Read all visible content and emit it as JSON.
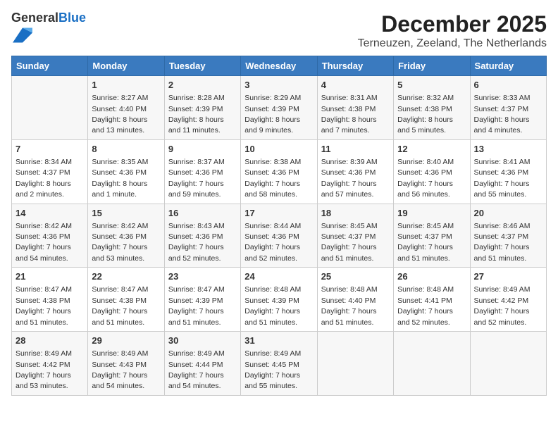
{
  "logo": {
    "general": "General",
    "blue": "Blue"
  },
  "title": "December 2025",
  "subtitle": "Terneuzen, Zeeland, The Netherlands",
  "days_of_week": [
    "Sunday",
    "Monday",
    "Tuesday",
    "Wednesday",
    "Thursday",
    "Friday",
    "Saturday"
  ],
  "weeks": [
    [
      {
        "day": null,
        "info": null
      },
      {
        "day": "1",
        "info": "Sunrise: 8:27 AM\nSunset: 4:40 PM\nDaylight: 8 hours\nand 13 minutes."
      },
      {
        "day": "2",
        "info": "Sunrise: 8:28 AM\nSunset: 4:39 PM\nDaylight: 8 hours\nand 11 minutes."
      },
      {
        "day": "3",
        "info": "Sunrise: 8:29 AM\nSunset: 4:39 PM\nDaylight: 8 hours\nand 9 minutes."
      },
      {
        "day": "4",
        "info": "Sunrise: 8:31 AM\nSunset: 4:38 PM\nDaylight: 8 hours\nand 7 minutes."
      },
      {
        "day": "5",
        "info": "Sunrise: 8:32 AM\nSunset: 4:38 PM\nDaylight: 8 hours\nand 5 minutes."
      },
      {
        "day": "6",
        "info": "Sunrise: 8:33 AM\nSunset: 4:37 PM\nDaylight: 8 hours\nand 4 minutes."
      }
    ],
    [
      {
        "day": "7",
        "info": "Sunrise: 8:34 AM\nSunset: 4:37 PM\nDaylight: 8 hours\nand 2 minutes."
      },
      {
        "day": "8",
        "info": "Sunrise: 8:35 AM\nSunset: 4:36 PM\nDaylight: 8 hours\nand 1 minute."
      },
      {
        "day": "9",
        "info": "Sunrise: 8:37 AM\nSunset: 4:36 PM\nDaylight: 7 hours\nand 59 minutes."
      },
      {
        "day": "10",
        "info": "Sunrise: 8:38 AM\nSunset: 4:36 PM\nDaylight: 7 hours\nand 58 minutes."
      },
      {
        "day": "11",
        "info": "Sunrise: 8:39 AM\nSunset: 4:36 PM\nDaylight: 7 hours\nand 57 minutes."
      },
      {
        "day": "12",
        "info": "Sunrise: 8:40 AM\nSunset: 4:36 PM\nDaylight: 7 hours\nand 56 minutes."
      },
      {
        "day": "13",
        "info": "Sunrise: 8:41 AM\nSunset: 4:36 PM\nDaylight: 7 hours\nand 55 minutes."
      }
    ],
    [
      {
        "day": "14",
        "info": "Sunrise: 8:42 AM\nSunset: 4:36 PM\nDaylight: 7 hours\nand 54 minutes."
      },
      {
        "day": "15",
        "info": "Sunrise: 8:42 AM\nSunset: 4:36 PM\nDaylight: 7 hours\nand 53 minutes."
      },
      {
        "day": "16",
        "info": "Sunrise: 8:43 AM\nSunset: 4:36 PM\nDaylight: 7 hours\nand 52 minutes."
      },
      {
        "day": "17",
        "info": "Sunrise: 8:44 AM\nSunset: 4:36 PM\nDaylight: 7 hours\nand 52 minutes."
      },
      {
        "day": "18",
        "info": "Sunrise: 8:45 AM\nSunset: 4:37 PM\nDaylight: 7 hours\nand 51 minutes."
      },
      {
        "day": "19",
        "info": "Sunrise: 8:45 AM\nSunset: 4:37 PM\nDaylight: 7 hours\nand 51 minutes."
      },
      {
        "day": "20",
        "info": "Sunrise: 8:46 AM\nSunset: 4:37 PM\nDaylight: 7 hours\nand 51 minutes."
      }
    ],
    [
      {
        "day": "21",
        "info": "Sunrise: 8:47 AM\nSunset: 4:38 PM\nDaylight: 7 hours\nand 51 minutes."
      },
      {
        "day": "22",
        "info": "Sunrise: 8:47 AM\nSunset: 4:38 PM\nDaylight: 7 hours\nand 51 minutes."
      },
      {
        "day": "23",
        "info": "Sunrise: 8:47 AM\nSunset: 4:39 PM\nDaylight: 7 hours\nand 51 minutes."
      },
      {
        "day": "24",
        "info": "Sunrise: 8:48 AM\nSunset: 4:39 PM\nDaylight: 7 hours\nand 51 minutes."
      },
      {
        "day": "25",
        "info": "Sunrise: 8:48 AM\nSunset: 4:40 PM\nDaylight: 7 hours\nand 51 minutes."
      },
      {
        "day": "26",
        "info": "Sunrise: 8:48 AM\nSunset: 4:41 PM\nDaylight: 7 hours\nand 52 minutes."
      },
      {
        "day": "27",
        "info": "Sunrise: 8:49 AM\nSunset: 4:42 PM\nDaylight: 7 hours\nand 52 minutes."
      }
    ],
    [
      {
        "day": "28",
        "info": "Sunrise: 8:49 AM\nSunset: 4:42 PM\nDaylight: 7 hours\nand 53 minutes."
      },
      {
        "day": "29",
        "info": "Sunrise: 8:49 AM\nSunset: 4:43 PM\nDaylight: 7 hours\nand 54 minutes."
      },
      {
        "day": "30",
        "info": "Sunrise: 8:49 AM\nSunset: 4:44 PM\nDaylight: 7 hours\nand 54 minutes."
      },
      {
        "day": "31",
        "info": "Sunrise: 8:49 AM\nSunset: 4:45 PM\nDaylight: 7 hours\nand 55 minutes."
      },
      {
        "day": null,
        "info": null
      },
      {
        "day": null,
        "info": null
      },
      {
        "day": null,
        "info": null
      }
    ]
  ]
}
